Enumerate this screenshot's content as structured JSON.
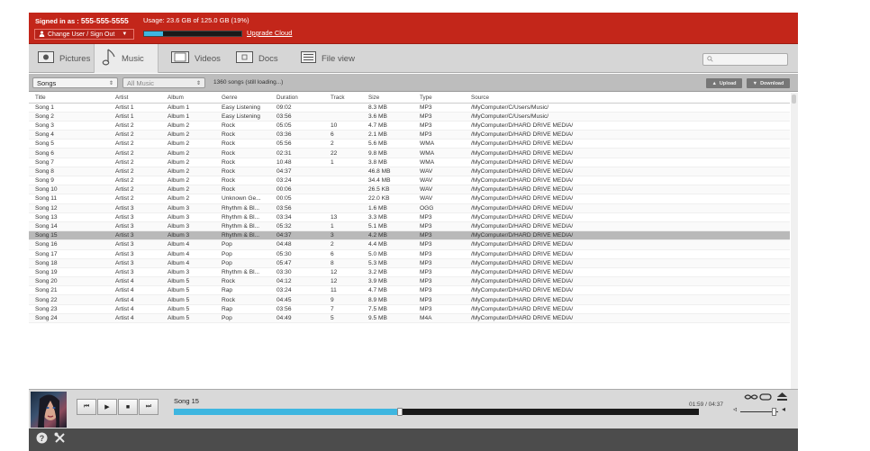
{
  "header": {
    "signed_label": "Signed in as : ",
    "phone": "555-555-5555",
    "usage": "Usage: 23.6 GB of 125.0 GB (19%)",
    "usage_fraction": 0.19,
    "change_user": "Change User / Sign Out",
    "upgrade": "Upgrade Cloud"
  },
  "tabs": [
    {
      "label": "Pictures",
      "icon": "camera-icon"
    },
    {
      "label": "Music",
      "icon": "music-note-icon",
      "active": true
    },
    {
      "label": "Videos",
      "icon": "film-icon"
    },
    {
      "label": "Docs",
      "icon": "document-icon"
    },
    {
      "label": "File view",
      "icon": "list-icon"
    }
  ],
  "search": {
    "placeholder": ""
  },
  "filters": {
    "view": "Songs",
    "album": "All Music",
    "count": "1360 songs (still loading...)",
    "upload": "Upload",
    "download": "Download"
  },
  "columns": [
    "Title",
    "Artist",
    "Album",
    "Genre",
    "Duration",
    "Track",
    "Size",
    "Type",
    "Source"
  ],
  "rows": [
    [
      "Song 1",
      "Artist 1",
      "Album 1",
      "Easy Listening",
      "09:02",
      "",
      "8.3 MB",
      "MP3",
      "/MyComputer/C/Users/Music/"
    ],
    [
      "Song 2",
      "Artist 1",
      "Album 1",
      "Easy Listening",
      "03:56",
      "",
      "3.6 MB",
      "MP3",
      "/MyComputer/C/Users/Music/"
    ],
    [
      "Song 3",
      "Artist 2",
      "Album 2",
      "Rock",
      "05:05",
      "10",
      "4.7 MB",
      "MP3",
      "/MyComputer/D/HARD DRIVE MEDIA/"
    ],
    [
      "Song 4",
      "Artist 2",
      "Album 2",
      "Rock",
      "03:36",
      "6",
      "2.1 MB",
      "MP3",
      "/MyComputer/D/HARD DRIVE MEDIA/"
    ],
    [
      "Song 5",
      "Artist 2",
      "Album 2",
      "Rock",
      "05:56",
      "2",
      "5.6 MB",
      "WMA",
      "/MyComputer/D/HARD DRIVE MEDIA/"
    ],
    [
      "Song 6",
      "Artist 2",
      "Album 2",
      "Rock",
      "02:31",
      "22",
      "9.8 MB",
      "WMA",
      "/MyComputer/D/HARD DRIVE MEDIA/"
    ],
    [
      "Song 7",
      "Artist 2",
      "Album 2",
      "Rock",
      "10:48",
      "1",
      "3.8 MB",
      "WMA",
      "/MyComputer/D/HARD DRIVE MEDIA/"
    ],
    [
      "Song 8",
      "Artist 2",
      "Album 2",
      "Rock",
      "04:37",
      "",
      "46.8 MB",
      "WAV",
      "/MyComputer/D/HARD DRIVE MEDIA/"
    ],
    [
      "Song 9",
      "Artist 2",
      "Album 2",
      "Rock",
      "03:24",
      "",
      "34.4 MB",
      "WAV",
      "/MyComputer/D/HARD DRIVE MEDIA/"
    ],
    [
      "Song 10",
      "Artist 2",
      "Album 2",
      "Rock",
      "00:06",
      "",
      "26.5 KB",
      "WAV",
      "/MyComputer/D/HARD DRIVE MEDIA/"
    ],
    [
      "Song 11",
      "Artist 2",
      "Album 2",
      "Unknown Ge...",
      "00:05",
      "",
      "22.0 KB",
      "WAV",
      "/MyComputer/D/HARD DRIVE MEDIA/"
    ],
    [
      "Song 12",
      "Artist 3",
      "Album 3",
      "Rhythm & Bl...",
      "03:56",
      "",
      "1.6 MB",
      "OGG",
      "/MyComputer/D/HARD DRIVE MEDIA/"
    ],
    [
      "Song 13",
      "Artist 3",
      "Album 3",
      "Rhythm & Bl...",
      "03:34",
      "13",
      "3.3 MB",
      "MP3",
      "/MyComputer/D/HARD DRIVE MEDIA/"
    ],
    [
      "Song 14",
      "Artist 3",
      "Album 3",
      "Rhythm & Bl...",
      "05:32",
      "1",
      "5.1 MB",
      "MP3",
      "/MyComputer/D/HARD DRIVE MEDIA/"
    ],
    [
      "Song 15",
      "Artist 3",
      "Album 3",
      "Rhythm & Bl...",
      "04:37",
      "3",
      "4.2 MB",
      "MP3",
      "/MyComputer/D/HARD DRIVE MEDIA/"
    ],
    [
      "Song 16",
      "Artist 3",
      "Album 4",
      "Pop",
      "04:48",
      "2",
      "4.4 MB",
      "MP3",
      "/MyComputer/D/HARD DRIVE MEDIA/"
    ],
    [
      "Song 17",
      "Artist 3",
      "Album 4",
      "Pop",
      "05:30",
      "6",
      "5.0 MB",
      "MP3",
      "/MyComputer/D/HARD DRIVE MEDIA/"
    ],
    [
      "Song 18",
      "Artist 3",
      "Album 4",
      "Pop",
      "05:47",
      "8",
      "5.3 MB",
      "MP3",
      "/MyComputer/D/HARD DRIVE MEDIA/"
    ],
    [
      "Song 19",
      "Artist 3",
      "Album 3",
      "Rhythm & Bl...",
      "03:30",
      "12",
      "3.2 MB",
      "MP3",
      "/MyComputer/D/HARD DRIVE MEDIA/"
    ],
    [
      "Song 20",
      "Artist 4",
      "Album 5",
      "Rock",
      "04:12",
      "12",
      "3.9 MB",
      "MP3",
      "/MyComputer/D/HARD DRIVE MEDIA/"
    ],
    [
      "Song 21",
      "Artist 4",
      "Album 5",
      "Rap",
      "03:24",
      "11",
      "4.7 MB",
      "MP3",
      "/MyComputer/D/HARD DRIVE MEDIA/"
    ],
    [
      "Song 22",
      "Artist 4",
      "Album 5",
      "Rock",
      "04:45",
      "9",
      "8.9 MB",
      "MP3",
      "/MyComputer/D/HARD DRIVE MEDIA/"
    ],
    [
      "Song 23",
      "Artist 4",
      "Album 5",
      "Rap",
      "03:56",
      "7",
      "7.5 MB",
      "MP3",
      "/MyComputer/D/HARD DRIVE MEDIA/"
    ],
    [
      "Song 24",
      "Artist 4",
      "Album 5",
      "Pop",
      "04:49",
      "5",
      "9.5 MB",
      "M4A",
      "/MyComputer/D/HARD DRIVE MEDIA/"
    ]
  ],
  "selected_row": 14,
  "player": {
    "now_playing": "Song 15",
    "time": "01:59 / 04:37",
    "progress_fraction": 0.43,
    "volume_fraction": 0.9
  },
  "colors": {
    "accent": "#c3261a",
    "progress": "#3eb6e0"
  }
}
